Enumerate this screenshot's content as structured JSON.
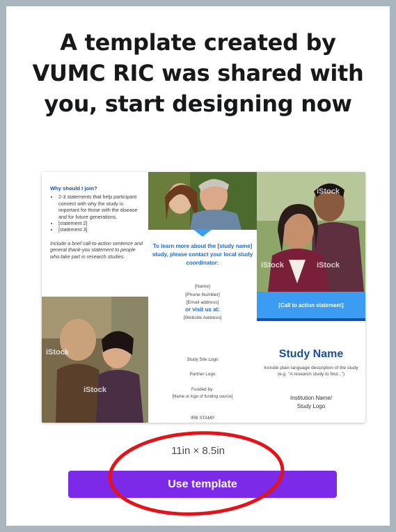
{
  "dialog": {
    "headline": "A template created by VUMC RIC was shared with you, start designing now",
    "dimensions": "11in × 8.5in",
    "use_template_label": "Use template",
    "accent_color": "#7d2ae8"
  },
  "preview": {
    "panel1": {
      "heading": "Why should I join?",
      "bullets": [
        "2-3 statements that help participant connect with why the study is important for those with the disease and for future generations.",
        "[statement 2]",
        "[statement 3]"
      ],
      "closing": "Include a brief call-to-action sentence and general thank-you statement to people who take part in research studies.",
      "watermark": "iStock"
    },
    "panel2": {
      "learn_more": "To learn more about the [study name] study, please contact your local study coordinator:",
      "name": "[Name]",
      "phone": "[Phone Number]",
      "email": "[Email address]",
      "visit": "or visit us at:",
      "website": "[Website Address]",
      "site_logo": "Study Site Logo",
      "partner_logo": "Partner Logo",
      "funded_by": "Funded by:",
      "funding_source": "[Name or logo of funding source]",
      "irb": "IRB STAMP"
    },
    "panel3": {
      "cta": "[Call to action statement]",
      "study_name": "Study Name",
      "description": "Include plain language description of the study (e.g. \"A research study to find...\")",
      "institution_line1": "Institution Name/",
      "institution_line2": "Study Logo",
      "watermark": "iStock"
    }
  },
  "annotation": {
    "circle_color": "#e0151b"
  }
}
